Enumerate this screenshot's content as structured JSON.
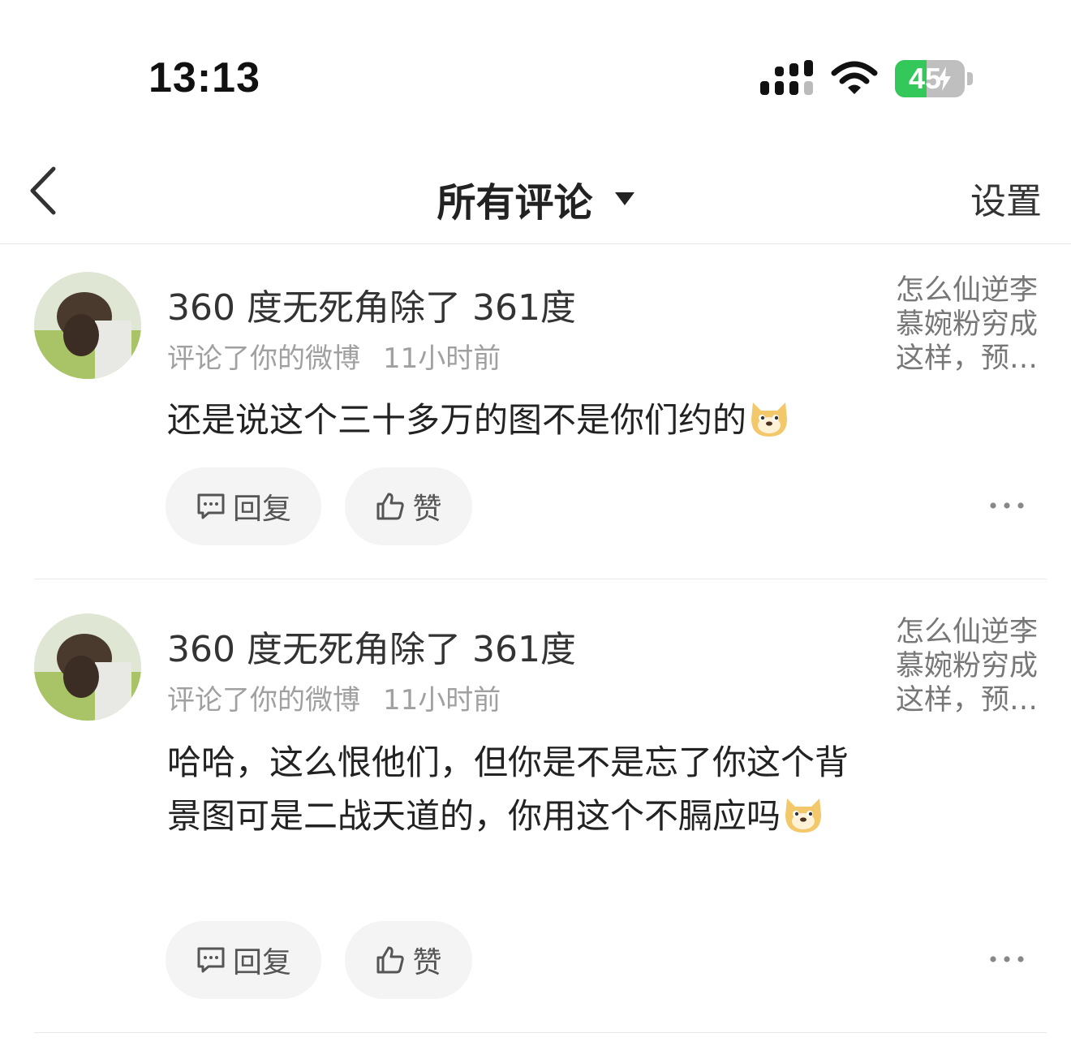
{
  "status_bar": {
    "time": "13:13",
    "battery_level": "45",
    "battery_fraction": 0.45,
    "battery_color": "#34c759",
    "icons": [
      "signal-icon",
      "wifi-icon",
      "battery-icon",
      "charging-bolt-icon"
    ]
  },
  "nav": {
    "back_icon": "chevron-left-icon",
    "title": "所有评论",
    "dropdown_icon": "caret-down-icon",
    "settings_label": "设置"
  },
  "comments": [
    {
      "username": "360 度无死角除了 361度",
      "action": "评论了你的微博",
      "time": "11小时前",
      "content": "还是说这个三十多万的图不是你们约的",
      "emoji": "doge-emoji",
      "preview": "怎么仙逆李慕婉粉穷成这样，预…",
      "reply_label": "回复",
      "like_label": "赞",
      "more_icon": "more-dots-icon"
    },
    {
      "username": "360 度无死角除了 361度",
      "action": "评论了你的微博",
      "time": "11小时前",
      "content": "哈哈，这么恨他们，但你是不是忘了你这个背景图可是二战天道的，你用这个不膈应吗",
      "emoji": "doge-emoji",
      "preview": "怎么仙逆李慕婉粉穷成这样，预…",
      "reply_label": "回复",
      "like_label": "赞",
      "more_icon": "more-dots-icon"
    }
  ]
}
